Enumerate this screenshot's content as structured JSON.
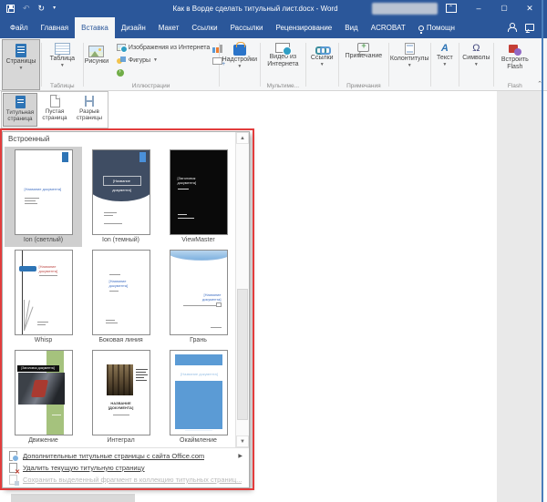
{
  "titlebar": {
    "title": "Как в Ворде сделать титульный лист.docx - Word"
  },
  "tabs": {
    "items": [
      "Файл",
      "Главная",
      "Вставка",
      "Дизайн",
      "Макет",
      "Ссылки",
      "Рассылки",
      "Рецензирование",
      "Вид",
      "ACROBAT"
    ],
    "selected": "Вставка",
    "help": "Помощн"
  },
  "ribbon": {
    "pages": "Страницы",
    "table": "Таблица",
    "tables_group": "Таблицы",
    "pictures": "Рисунки",
    "online_pictures": "Изображения из Интернета",
    "shapes": "Фигуры",
    "illustrations_group": "Иллюстрации",
    "addins": "Надстройки",
    "video": "Видео из Интернета",
    "media_group": "Мультиме...",
    "links": "Ссылки",
    "comment": "Примечание",
    "comments_group": "Примечания",
    "header_footer": "Колонтитулы",
    "text": "Текст",
    "symbols": "Символы",
    "flash": "Встроить Flash",
    "flash_group": "Flash"
  },
  "pages_menu": {
    "cover": "Титульная страница",
    "blank": "Пустая страница",
    "break": "Разрыв страницы"
  },
  "gallery": {
    "header": "Встроенный",
    "items": [
      {
        "name": "Ion (светлый)",
        "placeholder": "[Название документа]",
        "selected": true
      },
      {
        "name": "Ion (темный)",
        "placeholder": "[Название документа]"
      },
      {
        "name": "ViewMaster",
        "placeholder": "[Заголовок документа]"
      },
      {
        "name": "Whisp",
        "placeholder": "[Название документа]"
      },
      {
        "name": "Боковая линия",
        "placeholder": "[Название документа]"
      },
      {
        "name": "Грань",
        "placeholder": "[Название документа]"
      },
      {
        "name": "Движение",
        "placeholder": "[Заголовок документа]"
      },
      {
        "name": "Интеграл",
        "placeholder": "НАЗВАНИЕ [ДОКУМЕНТА]"
      },
      {
        "name": "Окаймление",
        "placeholder": "[Название документа]"
      }
    ],
    "footer": [
      {
        "label": "Дополнительные титульные страницы с сайта Office.com",
        "submenu": true
      },
      {
        "label": "Удалить текущую титульную страницу"
      },
      {
        "label": "Сохранить выделенный фрагмент в коллекцию титульных страниц...",
        "disabled": true
      }
    ]
  },
  "colors": {
    "accent": "#2b579a",
    "annotation": "#e23c3c",
    "selection": "#cfcfcf",
    "cover_blue": "#5b9bd5"
  }
}
